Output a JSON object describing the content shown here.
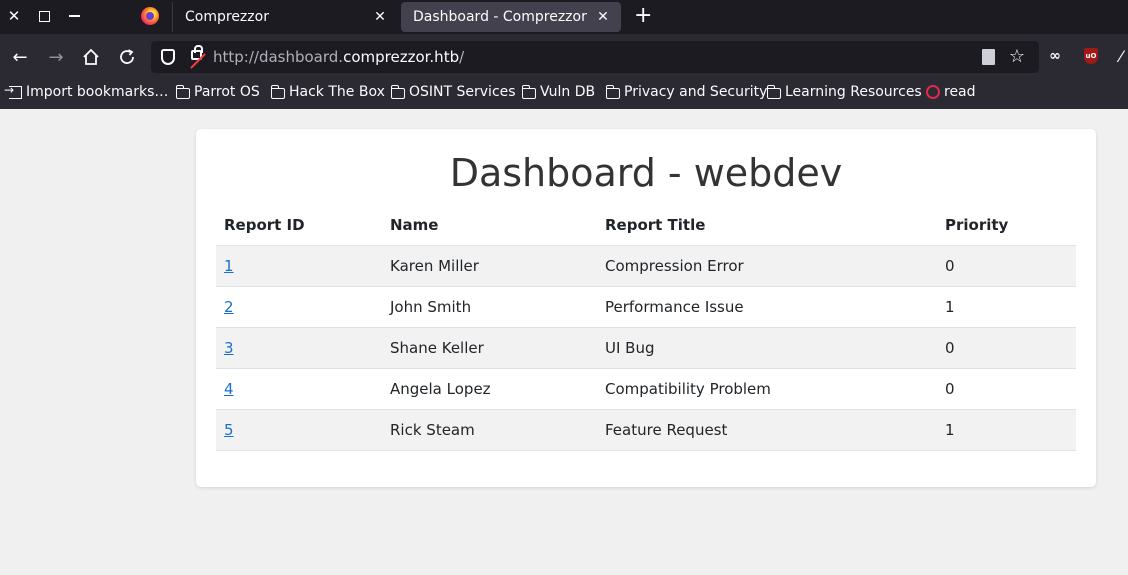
{
  "browser": {
    "tabs": [
      {
        "title": "Comprezzor",
        "active": false
      },
      {
        "title": "Dashboard - Comprezzor",
        "active": true
      }
    ],
    "url_prefix": "http://dashboard.",
    "url_host": "comprezzor.htb",
    "url_suffix": "/",
    "bookmarks": [
      {
        "label": "Import bookmarks…",
        "icon": "import-icon"
      },
      {
        "label": "Parrot OS",
        "icon": "folder-icon"
      },
      {
        "label": "Hack The Box",
        "icon": "folder-icon"
      },
      {
        "label": "OSINT Services",
        "icon": "folder-icon"
      },
      {
        "label": "Vuln DB",
        "icon": "folder-icon"
      },
      {
        "label": "Privacy and Security",
        "icon": "folder-icon"
      },
      {
        "label": "Learning Resources",
        "icon": "folder-icon"
      },
      {
        "label": "read",
        "icon": "read-icon"
      }
    ]
  },
  "page": {
    "title": "Dashboard - webdev",
    "table": {
      "headers": [
        "Report ID",
        "Name",
        "Report Title",
        "Priority"
      ],
      "rows": [
        {
          "id": "1",
          "name": "Karen Miller",
          "report_title": "Compression Error",
          "priority": "0"
        },
        {
          "id": "2",
          "name": "John Smith",
          "report_title": "Performance Issue",
          "priority": "1"
        },
        {
          "id": "3",
          "name": "Shane Keller",
          "report_title": "UI Bug",
          "priority": "0"
        },
        {
          "id": "4",
          "name": "Angela Lopez",
          "report_title": "Compatibility Problem",
          "priority": "0"
        },
        {
          "id": "5",
          "name": "Rick Steam",
          "report_title": "Feature Request",
          "priority": "1"
        }
      ]
    }
  },
  "colors": {
    "tab_bar": "#1c1b22",
    "toolbar": "#2b2a33",
    "link": "#1a6fd0",
    "page_bg": "#f0f0f0"
  }
}
